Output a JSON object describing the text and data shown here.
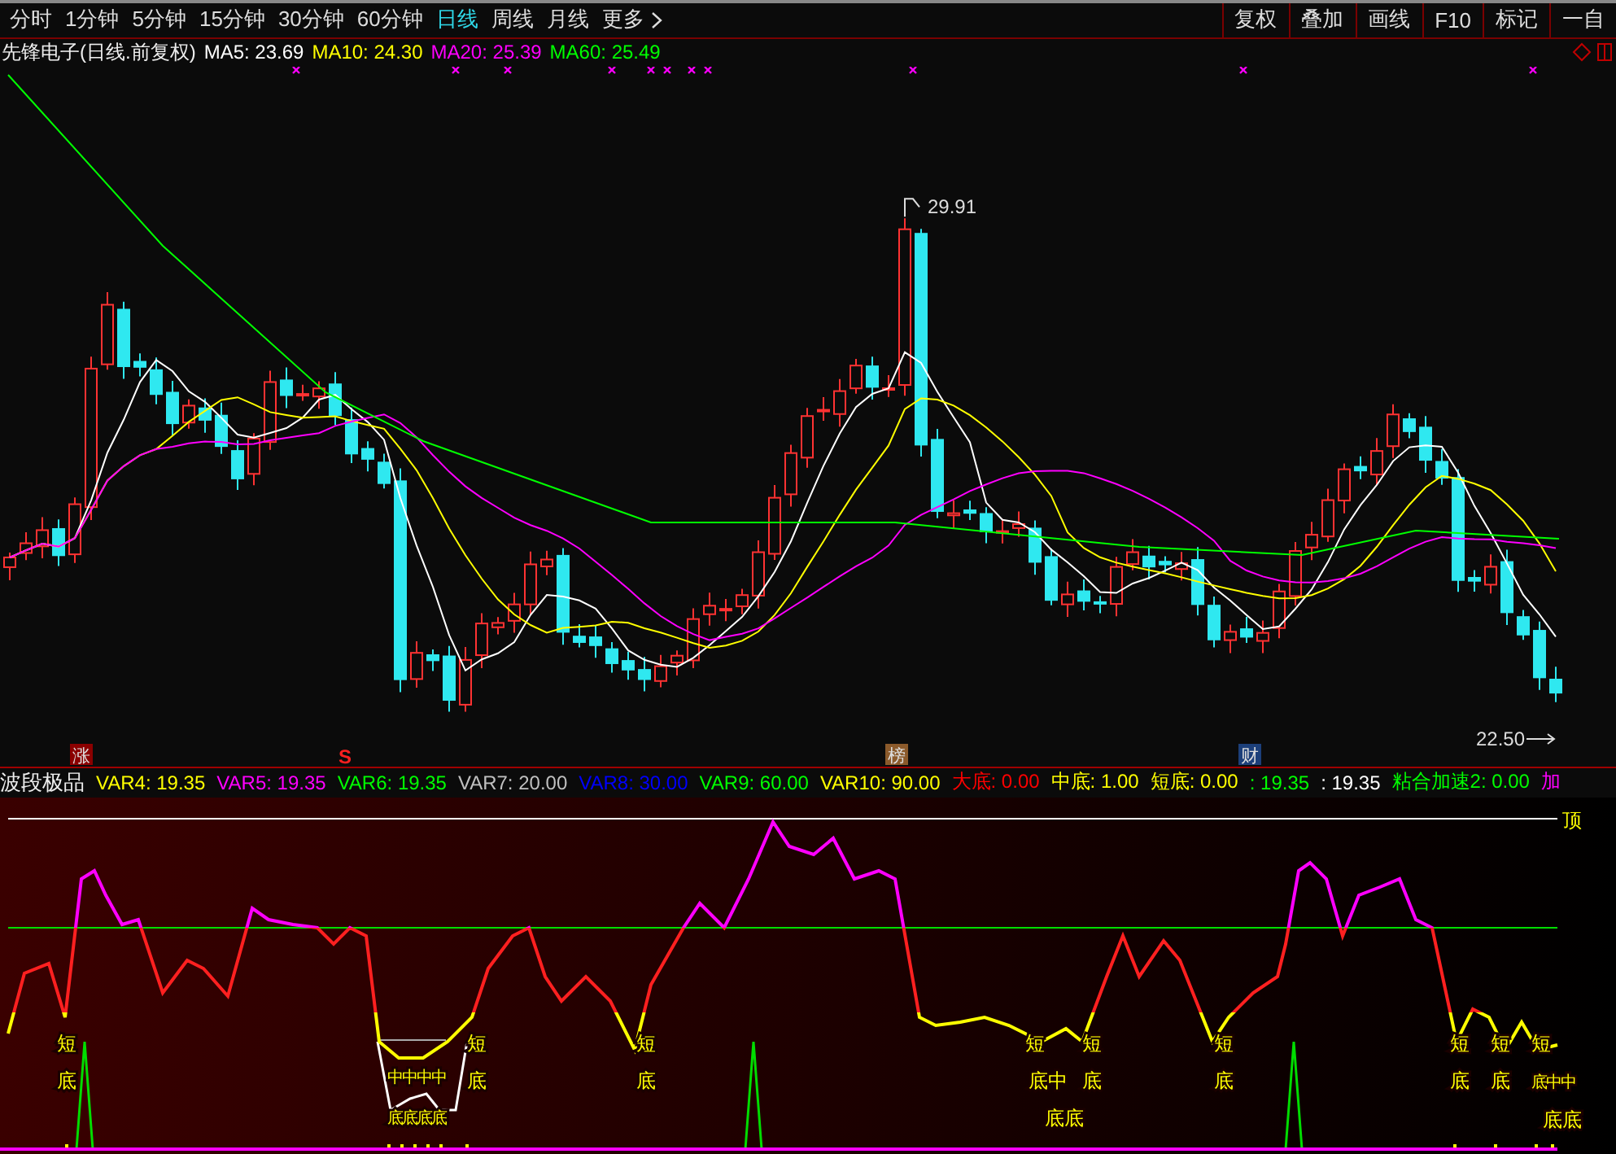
{
  "toolbar": {
    "tabs": [
      {
        "label": "分时",
        "selected": false
      },
      {
        "label": "1分钟",
        "selected": false
      },
      {
        "label": "5分钟",
        "selected": false
      },
      {
        "label": "15分钟",
        "selected": false
      },
      {
        "label": "30分钟",
        "selected": false
      },
      {
        "label": "60分钟",
        "selected": false
      },
      {
        "label": "日线",
        "selected": true
      },
      {
        "label": "周线",
        "selected": false
      },
      {
        "label": "月线",
        "selected": false
      },
      {
        "label": "更多",
        "selected": false
      }
    ],
    "buttons": [
      "复权",
      "叠加",
      "画线",
      "F10",
      "标记",
      "一自"
    ]
  },
  "price_chart": {
    "title": "先锋电子(日线.前复权)",
    "indicators": [
      {
        "label": "MA5: 23.69",
        "color": "#ffffff"
      },
      {
        "label": "MA10: 24.30",
        "color": "#ffff00"
      },
      {
        "label": "MA20: 25.39",
        "color": "#ff00ff"
      },
      {
        "label": "MA60: 25.49",
        "color": "#00ff00"
      }
    ],
    "high_label": "29.91",
    "low_label": "22.50",
    "events": [
      {
        "text": "涨",
        "kind": "box",
        "color": "#8b0000"
      },
      {
        "text": "S",
        "kind": "plain",
        "color": "#ff2020"
      },
      {
        "text": "榜",
        "kind": "box",
        "color": "#8b5a2b"
      },
      {
        "text": "财",
        "kind": "box",
        "color": "#1c3f7a"
      }
    ]
  },
  "indicator_panel": {
    "title": "波段极品",
    "values": [
      {
        "label": "VAR4: 19.35",
        "color": "#ffff00"
      },
      {
        "label": "VAR5: 19.35",
        "color": "#ff00ff"
      },
      {
        "label": "VAR6: 19.35",
        "color": "#00ff00"
      },
      {
        "label": "VAR7: 20.00",
        "color": "#c0c0c0"
      },
      {
        "label": "VAR8: 30.00",
        "color": "#0000ff"
      },
      {
        "label": "VAR9: 60.00",
        "color": "#00ff00"
      },
      {
        "label": "VAR10: 90.00",
        "color": "#ffff00"
      },
      {
        "label": "大底: 0.00",
        "color": "#ff0000"
      },
      {
        "label": "中底: 1.00",
        "color": "#ffff00"
      },
      {
        "label": "短底: 0.00",
        "color": "#ffff00"
      },
      {
        "label": ": 19.35",
        "color": "#00ff00"
      },
      {
        "label": ": 19.35",
        "color": "#ffffff"
      },
      {
        "label": "粘合加速2: 0.00",
        "color": "#00ff00"
      },
      {
        "label": "加",
        "color": "#ff00ff"
      }
    ],
    "top_label": "顶",
    "signal_labels": [
      {
        "text": "短"
      },
      {
        "text": "底"
      },
      {
        "text": "中中中中"
      },
      {
        "text": "底底底底"
      },
      {
        "text": "短"
      },
      {
        "text": "底"
      },
      {
        "text": "短"
      },
      {
        "text": "底"
      },
      {
        "text": "短"
      },
      {
        "text": "底中"
      },
      {
        "text": "底底"
      },
      {
        "text": "短"
      },
      {
        "text": "底"
      },
      {
        "text": "短"
      },
      {
        "text": "底"
      },
      {
        "text": "短"
      },
      {
        "text": "底"
      },
      {
        "text": "短"
      },
      {
        "text": "底"
      },
      {
        "text": "短"
      },
      {
        "text": "底中中"
      },
      {
        "text": "底底"
      }
    ]
  }
}
